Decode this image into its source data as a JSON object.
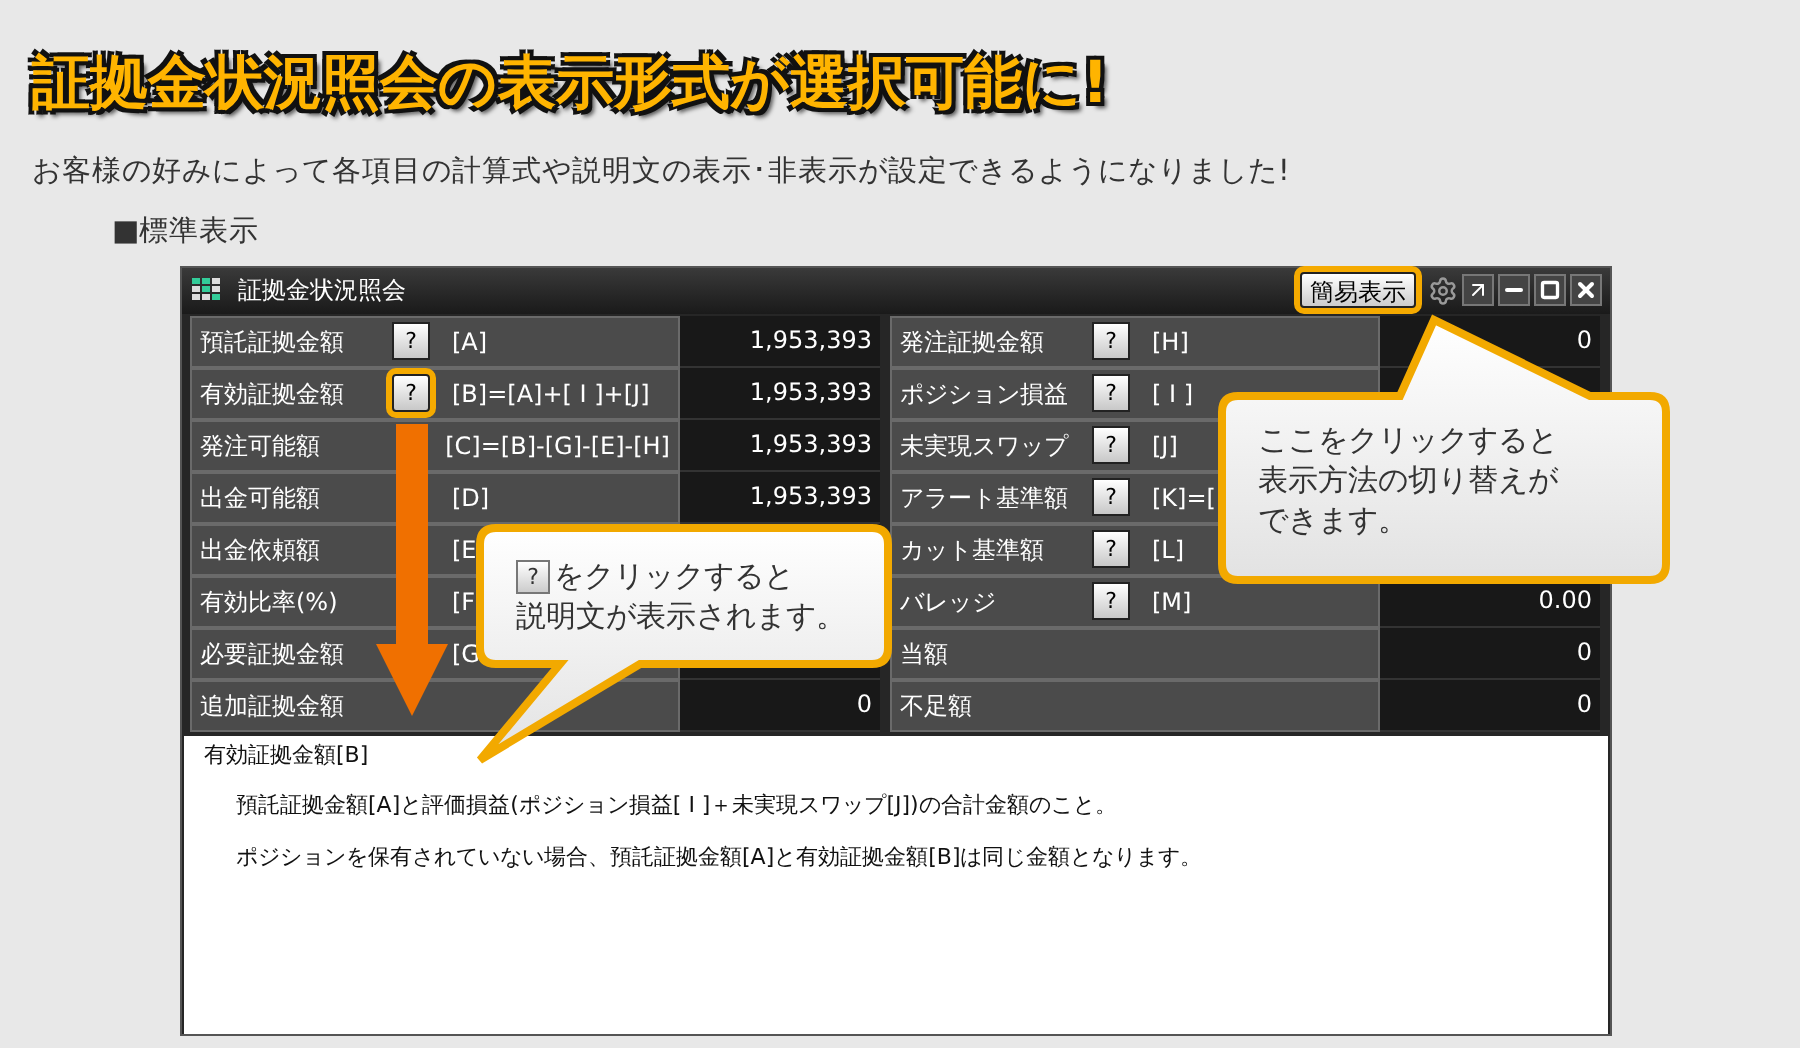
{
  "headline": "証拠金状況照会の表示形式が選択可能に!",
  "subtitle": "お客様の好みによって各項目の計算式や説明文の表示･非表示が設定できるようになりました!",
  "section_label": "■標準表示",
  "window": {
    "title": "証拠金状況照会",
    "mode_button": {
      "label": "簡易表示",
      "highlighted": true
    },
    "rows": [
      {
        "left": {
          "label": "預託証拠金額",
          "help": "?",
          "highlighted": false,
          "formula": "[A]",
          "value": "1,953,393"
        },
        "right": {
          "label": "発注証拠金額",
          "help": "?",
          "highlighted": false,
          "formula": "[H]",
          "value": "0"
        }
      },
      {
        "left": {
          "label": "有効証拠金額",
          "help": "?",
          "highlighted": true,
          "formula": "[B]=[A]+[ I ]+[J]",
          "value": "1,953,393"
        },
        "right": {
          "label": "ポジション損益",
          "help": "?",
          "highlighted": false,
          "formula": "[ I ]"
        }
      },
      {
        "left": {
          "label": "発注可能額",
          "formula": "[C]=[B]-[G]-[E]-[H]",
          "value": "1,953,393"
        },
        "right": {
          "label": "未実現スワップ",
          "help": "?",
          "highlighted": false,
          "formula": "[J]"
        }
      },
      {
        "left": {
          "label": "出金可能額",
          "formula": "[D]",
          "value": "1,953,393"
        },
        "right": {
          "label": "アラート基準額",
          "help": "?",
          "highlighted": false,
          "formula": "[K]=["
        }
      },
      {
        "left": {
          "label": "出金依頼額",
          "formula": "[E"
        },
        "right": {
          "label": "カット基準額",
          "help": "?",
          "highlighted": false,
          "formula": "[L]"
        }
      },
      {
        "left": {
          "label": "有効比率(%)",
          "formula": "[F"
        },
        "right": {
          "label": "バレッジ",
          "help": "?",
          "highlighted": false,
          "formula": "[M]",
          "value": "0.00"
        }
      },
      {
        "left": {
          "label": "必要証拠金額",
          "formula": "[G"
        },
        "right": {
          "label": "当額",
          "value": "0"
        }
      },
      {
        "left": {
          "label": "追加証拠金額",
          "value": "0"
        },
        "right": {
          "label": "不足額",
          "value": "0"
        }
      }
    ],
    "description": {
      "title": "有効証拠金額[B]",
      "lines": [
        "預託証拠金額[A]と評価損益(ポジション損益[ I ]＋未実現スワップ[J])の合計金額のこと。",
        "ポジションを保有されていない場合、預託証拠金額[A]と有効証拠金額[B]は同じ金額となります。"
      ]
    }
  },
  "callouts": [
    {
      "kind": "help",
      "icon_text": "?",
      "lines": [
        "をクリックすると",
        "説明文が表示されます。"
      ]
    },
    {
      "kind": "mode",
      "lines": [
        "ここをクリックすると",
        "表示方法の切り替えが",
        "できます。"
      ]
    }
  ]
}
